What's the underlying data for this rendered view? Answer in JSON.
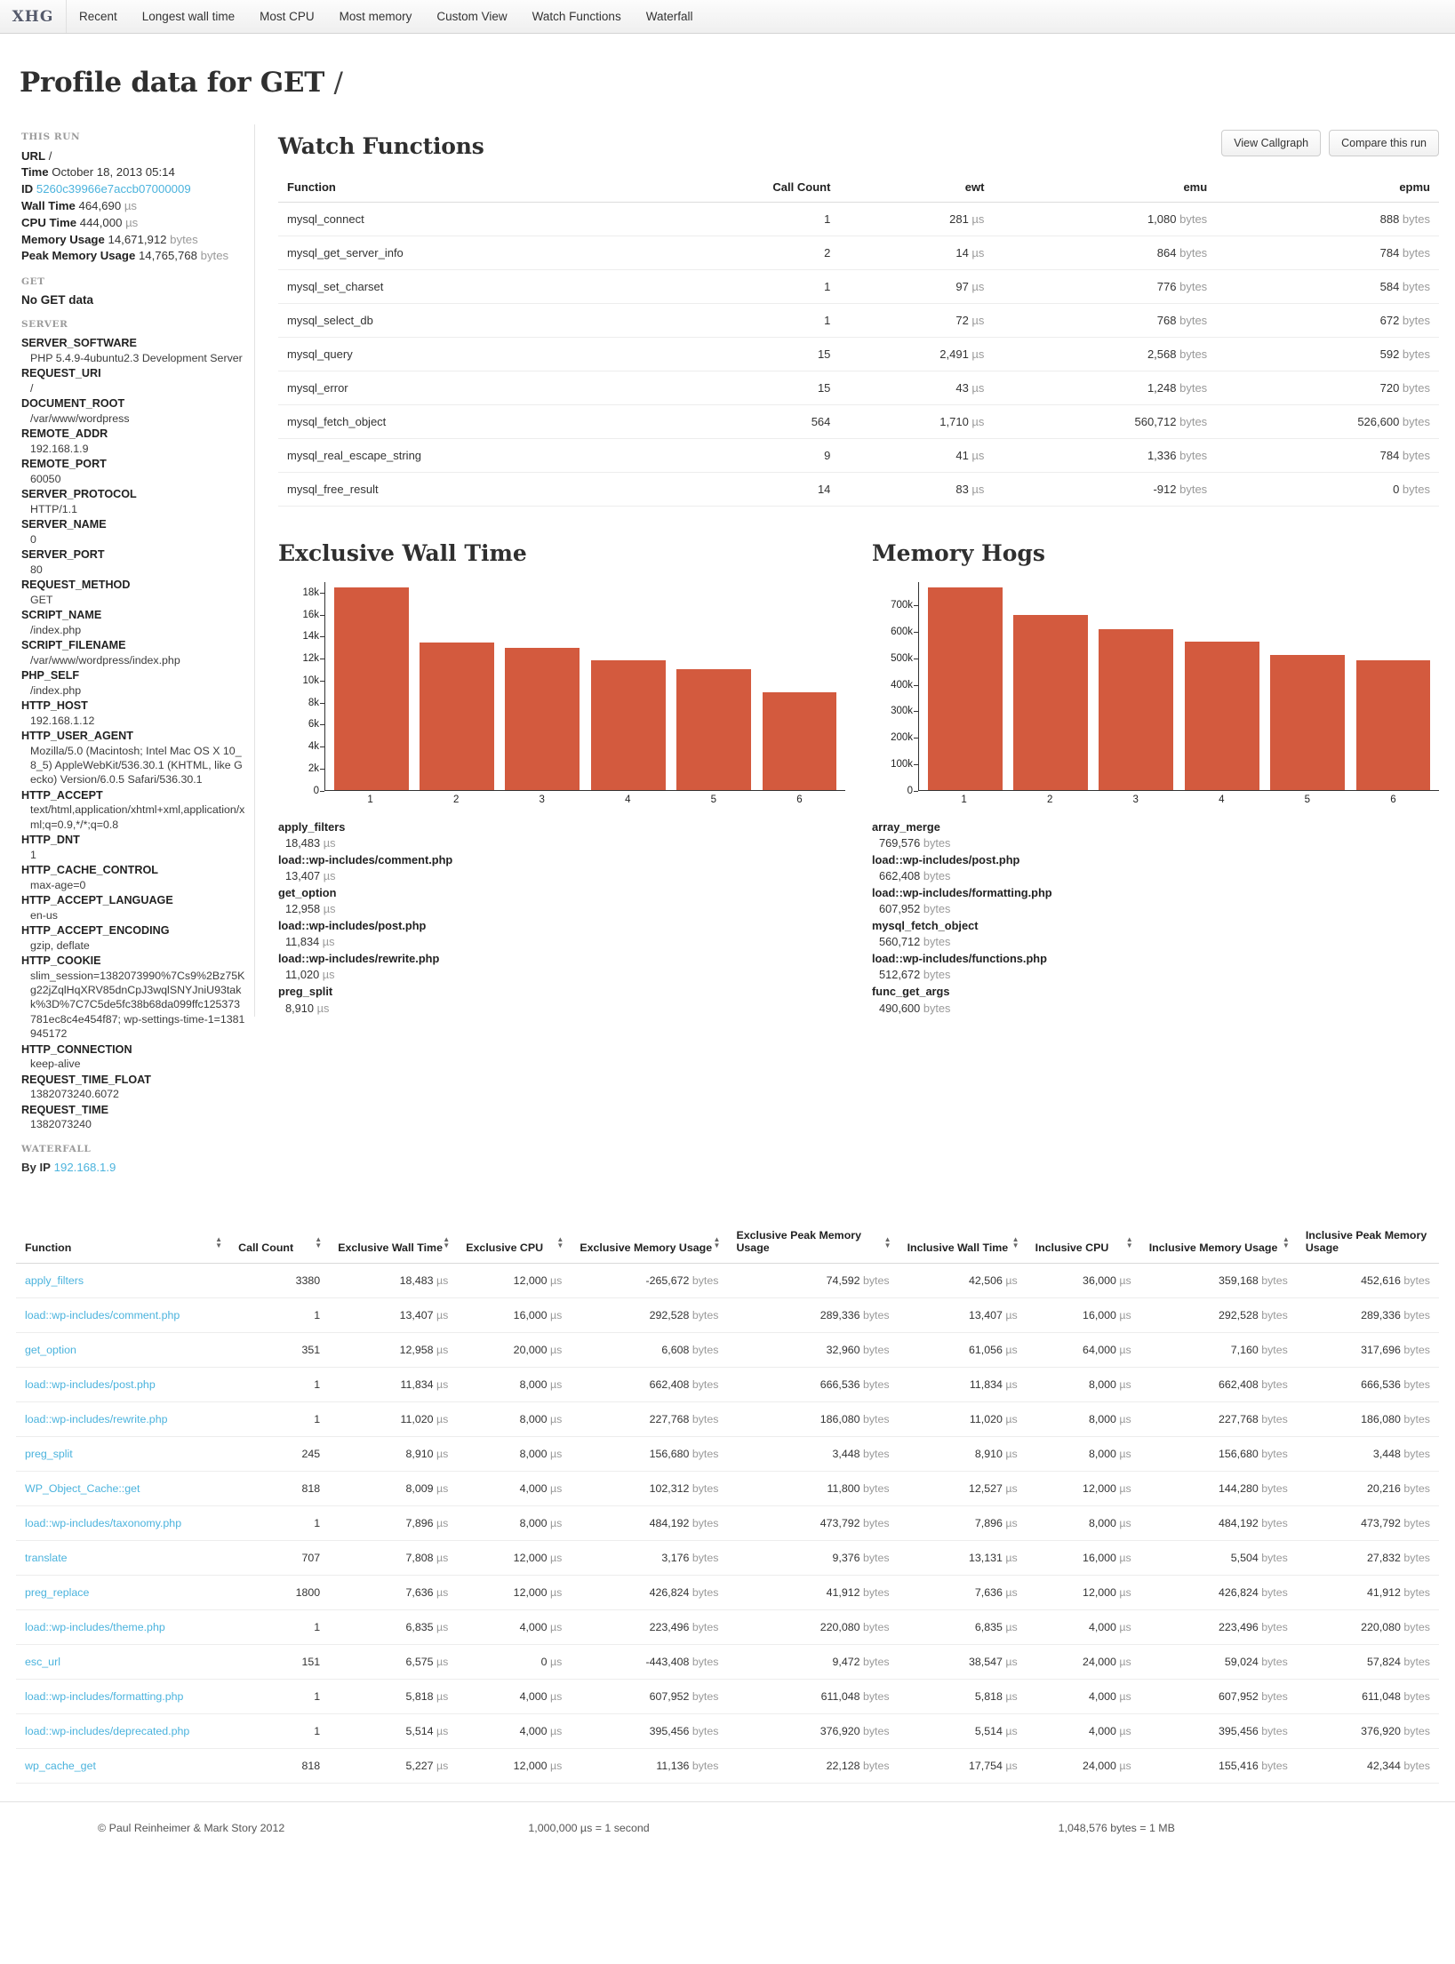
{
  "nav": {
    "brand": "XHG",
    "items": [
      {
        "label": "Recent"
      },
      {
        "label": "Longest wall time"
      },
      {
        "label": "Most CPU"
      },
      {
        "label": "Most memory"
      },
      {
        "label": "Custom View"
      },
      {
        "label": "Watch Functions"
      },
      {
        "label": "Waterfall"
      }
    ]
  },
  "page": {
    "title": "Profile data for GET",
    "title_path": "/"
  },
  "sidebar": {
    "this_run_heading": "THIS RUN",
    "this_run": [
      {
        "key": "URL",
        "value": "/",
        "unit": ""
      },
      {
        "key": "Time",
        "value": "October 18, 2013 05:14",
        "unit": ""
      },
      {
        "key": "ID",
        "value": "5260c39966e7accb07000009",
        "unit": "",
        "link": true
      },
      {
        "key": "Wall Time",
        "value": "464,690",
        "unit": "µs"
      },
      {
        "key": "CPU Time",
        "value": "444,000",
        "unit": "µs"
      },
      {
        "key": "Memory Usage",
        "value": "14,671,912",
        "unit": "bytes"
      },
      {
        "key": "Peak Memory Usage",
        "value": "14,765,768",
        "unit": "bytes"
      }
    ],
    "get_heading": "GET",
    "get_empty": "No GET data",
    "server_heading": "SERVER",
    "server": [
      {
        "key": "SERVER_SOFTWARE",
        "value": "PHP 5.4.9-4ubuntu2.3 Development Server"
      },
      {
        "key": "REQUEST_URI",
        "value": "/"
      },
      {
        "key": "DOCUMENT_ROOT",
        "value": "/var/www/wordpress"
      },
      {
        "key": "REMOTE_ADDR",
        "value": "192.168.1.9"
      },
      {
        "key": "REMOTE_PORT",
        "value": "60050"
      },
      {
        "key": "SERVER_PROTOCOL",
        "value": "HTTP/1.1"
      },
      {
        "key": "SERVER_NAME",
        "value": "0"
      },
      {
        "key": "SERVER_PORT",
        "value": "80"
      },
      {
        "key": "REQUEST_METHOD",
        "value": "GET"
      },
      {
        "key": "SCRIPT_NAME",
        "value": "/index.php"
      },
      {
        "key": "SCRIPT_FILENAME",
        "value": "/var/www/wordpress/index.php"
      },
      {
        "key": "PHP_SELF",
        "value": "/index.php"
      },
      {
        "key": "HTTP_HOST",
        "value": "192.168.1.12"
      },
      {
        "key": "HTTP_USER_AGENT",
        "value": "Mozilla/5.0 (Macintosh; Intel Mac OS X 10_8_5) AppleWebKit/536.30.1 (KHTML, like Gecko) Version/6.0.5 Safari/536.30.1"
      },
      {
        "key": "HTTP_ACCEPT",
        "value": "text/html,application/xhtml+xml,application/xml;q=0.9,*/*;q=0.8"
      },
      {
        "key": "HTTP_DNT",
        "value": "1"
      },
      {
        "key": "HTTP_CACHE_CONTROL",
        "value": "max-age=0"
      },
      {
        "key": "HTTP_ACCEPT_LANGUAGE",
        "value": "en-us"
      },
      {
        "key": "HTTP_ACCEPT_ENCODING",
        "value": "gzip, deflate"
      },
      {
        "key": "HTTP_COOKIE",
        "value": "slim_session=1382073990%7Cs9%2Bz75Kg22jZqlHqXRV85dnCpJ3wqlSNYJniU93takk%3D%7C7C5de5fc38b68da099ffc125373781ec8c4e454f87; wp-settings-time-1=1381945172"
      },
      {
        "key": "HTTP_CONNECTION",
        "value": "keep-alive"
      },
      {
        "key": "REQUEST_TIME_FLOAT",
        "value": "1382073240.6072"
      },
      {
        "key": "REQUEST_TIME",
        "value": "1382073240"
      }
    ],
    "waterfall_heading": "WATERFALL",
    "waterfall_label": "By IP",
    "waterfall_ip": "192.168.1.9"
  },
  "watch": {
    "title": "Watch Functions",
    "buttons": {
      "callgraph": "View Callgraph",
      "compare": "Compare this run"
    },
    "columns": [
      "Function",
      "Call Count",
      "ewt",
      "emu",
      "epmu"
    ],
    "units": {
      "time": "µs",
      "bytes": "bytes"
    },
    "rows": [
      {
        "fn": "mysql_connect",
        "calls": "1",
        "ewt": "281",
        "emu": "1,080",
        "epmu": "888"
      },
      {
        "fn": "mysql_get_server_info",
        "calls": "2",
        "ewt": "14",
        "emu": "864",
        "epmu": "784"
      },
      {
        "fn": "mysql_set_charset",
        "calls": "1",
        "ewt": "97",
        "emu": "776",
        "epmu": "584"
      },
      {
        "fn": "mysql_select_db",
        "calls": "1",
        "ewt": "72",
        "emu": "768",
        "epmu": "672"
      },
      {
        "fn": "mysql_query",
        "calls": "15",
        "ewt": "2,491",
        "emu": "2,568",
        "epmu": "592"
      },
      {
        "fn": "mysql_error",
        "calls": "15",
        "ewt": "43",
        "emu": "1,248",
        "epmu": "720"
      },
      {
        "fn": "mysql_fetch_object",
        "calls": "564",
        "ewt": "1,710",
        "emu": "560,712",
        "epmu": "526,600"
      },
      {
        "fn": "mysql_real_escape_string",
        "calls": "9",
        "ewt": "41",
        "emu": "1,336",
        "epmu": "784"
      },
      {
        "fn": "mysql_free_result",
        "calls": "14",
        "ewt": "83",
        "emu": "-912",
        "epmu": "0"
      }
    ]
  },
  "chart_data": [
    {
      "type": "bar",
      "title": "Exclusive Wall Time",
      "xlabel": "",
      "ylabel": "",
      "categories": [
        "1",
        "2",
        "3",
        "4",
        "5",
        "6"
      ],
      "values": [
        18483,
        13407,
        12958,
        11834,
        11020,
        8910
      ],
      "ylim": [
        0,
        19000
      ],
      "yticks": [
        0,
        2000,
        4000,
        6000,
        8000,
        10000,
        12000,
        14000,
        16000,
        18000
      ],
      "ytick_labels": [
        "0",
        "2k",
        "4k",
        "6k",
        "8k",
        "10k",
        "12k",
        "14k",
        "16k",
        "18k"
      ],
      "grid": false,
      "bar_color": "#d35a3e",
      "unit": "µs",
      "legend": [
        {
          "name": "apply_filters",
          "value": "18,483",
          "unit": "µs"
        },
        {
          "name": "load::wp-includes/comment.php",
          "value": "13,407",
          "unit": "µs"
        },
        {
          "name": "get_option",
          "value": "12,958",
          "unit": "µs"
        },
        {
          "name": "load::wp-includes/post.php",
          "value": "11,834",
          "unit": "µs"
        },
        {
          "name": "load::wp-includes/rewrite.php",
          "value": "11,020",
          "unit": "µs"
        },
        {
          "name": "preg_split",
          "value": "8,910",
          "unit": "µs"
        }
      ]
    },
    {
      "type": "bar",
      "title": "Memory Hogs",
      "xlabel": "",
      "ylabel": "",
      "categories": [
        "1",
        "2",
        "3",
        "4",
        "5",
        "6"
      ],
      "values": [
        769576,
        662408,
        607952,
        560712,
        512672,
        490600
      ],
      "ylim": [
        0,
        790000
      ],
      "yticks": [
        0,
        100000,
        200000,
        300000,
        400000,
        500000,
        600000,
        700000
      ],
      "ytick_labels": [
        "0",
        "100k",
        "200k",
        "300k",
        "400k",
        "500k",
        "600k",
        "700k"
      ],
      "grid": false,
      "bar_color": "#d35a3e",
      "unit": "bytes",
      "legend": [
        {
          "name": "array_merge",
          "value": "769,576",
          "unit": "bytes"
        },
        {
          "name": "load::wp-includes/post.php",
          "value": "662,408",
          "unit": "bytes"
        },
        {
          "name": "load::wp-includes/formatting.php",
          "value": "607,952",
          "unit": "bytes"
        },
        {
          "name": "mysql_fetch_object",
          "value": "560,712",
          "unit": "bytes"
        },
        {
          "name": "load::wp-includes/functions.php",
          "value": "512,672",
          "unit": "bytes"
        },
        {
          "name": "func_get_args",
          "value": "490,600",
          "unit": "bytes"
        }
      ]
    }
  ],
  "bigtable": {
    "columns": [
      "Function",
      "Call Count",
      "Exclusive Wall Time",
      "Exclusive CPU",
      "Exclusive Memory Usage",
      "Exclusive Peak Memory Usage",
      "Inclusive Wall Time",
      "Inclusive CPU",
      "Inclusive Memory Usage",
      "Inclusive Peak Memory Usage"
    ],
    "rows": [
      {
        "fn": "apply_filters",
        "calls": "3380",
        "ewt": "18,483",
        "ecpu": "12,000",
        "emu": "-265,672",
        "epmu": "74,592",
        "iwt": "42,506",
        "icpu": "36,000",
        "imu": "359,168",
        "ipmu": "452,616"
      },
      {
        "fn": "load::wp-includes/comment.php",
        "calls": "1",
        "ewt": "13,407",
        "ecpu": "16,000",
        "emu": "292,528",
        "epmu": "289,336",
        "iwt": "13,407",
        "icpu": "16,000",
        "imu": "292,528",
        "ipmu": "289,336"
      },
      {
        "fn": "get_option",
        "calls": "351",
        "ewt": "12,958",
        "ecpu": "20,000",
        "emu": "6,608",
        "epmu": "32,960",
        "iwt": "61,056",
        "icpu": "64,000",
        "imu": "7,160",
        "ipmu": "317,696"
      },
      {
        "fn": "load::wp-includes/post.php",
        "calls": "1",
        "ewt": "11,834",
        "ecpu": "8,000",
        "emu": "662,408",
        "epmu": "666,536",
        "iwt": "11,834",
        "icpu": "8,000",
        "imu": "662,408",
        "ipmu": "666,536"
      },
      {
        "fn": "load::wp-includes/rewrite.php",
        "calls": "1",
        "ewt": "11,020",
        "ecpu": "8,000",
        "emu": "227,768",
        "epmu": "186,080",
        "iwt": "11,020",
        "icpu": "8,000",
        "imu": "227,768",
        "ipmu": "186,080"
      },
      {
        "fn": "preg_split",
        "calls": "245",
        "ewt": "8,910",
        "ecpu": "8,000",
        "emu": "156,680",
        "epmu": "3,448",
        "iwt": "8,910",
        "icpu": "8,000",
        "imu": "156,680",
        "ipmu": "3,448"
      },
      {
        "fn": "WP_Object_Cache::get",
        "calls": "818",
        "ewt": "8,009",
        "ecpu": "4,000",
        "emu": "102,312",
        "epmu": "11,800",
        "iwt": "12,527",
        "icpu": "12,000",
        "imu": "144,280",
        "ipmu": "20,216"
      },
      {
        "fn": "load::wp-includes/taxonomy.php",
        "calls": "1",
        "ewt": "7,896",
        "ecpu": "8,000",
        "emu": "484,192",
        "epmu": "473,792",
        "iwt": "7,896",
        "icpu": "8,000",
        "imu": "484,192",
        "ipmu": "473,792"
      },
      {
        "fn": "translate",
        "calls": "707",
        "ewt": "7,808",
        "ecpu": "12,000",
        "emu": "3,176",
        "epmu": "9,376",
        "iwt": "13,131",
        "icpu": "16,000",
        "imu": "5,504",
        "ipmu": "27,832"
      },
      {
        "fn": "preg_replace",
        "calls": "1800",
        "ewt": "7,636",
        "ecpu": "12,000",
        "emu": "426,824",
        "epmu": "41,912",
        "iwt": "7,636",
        "icpu": "12,000",
        "imu": "426,824",
        "ipmu": "41,912"
      },
      {
        "fn": "load::wp-includes/theme.php",
        "calls": "1",
        "ewt": "6,835",
        "ecpu": "4,000",
        "emu": "223,496",
        "epmu": "220,080",
        "iwt": "6,835",
        "icpu": "4,000",
        "imu": "223,496",
        "ipmu": "220,080"
      },
      {
        "fn": "esc_url",
        "calls": "151",
        "ewt": "6,575",
        "ecpu": "0",
        "emu": "-443,408",
        "epmu": "9,472",
        "iwt": "38,547",
        "icpu": "24,000",
        "imu": "59,024",
        "ipmu": "57,824"
      },
      {
        "fn": "load::wp-includes/formatting.php",
        "calls": "1",
        "ewt": "5,818",
        "ecpu": "4,000",
        "emu": "607,952",
        "epmu": "611,048",
        "iwt": "5,818",
        "icpu": "4,000",
        "imu": "607,952",
        "ipmu": "611,048"
      },
      {
        "fn": "load::wp-includes/deprecated.php",
        "calls": "1",
        "ewt": "5,514",
        "ecpu": "4,000",
        "emu": "395,456",
        "epmu": "376,920",
        "iwt": "5,514",
        "icpu": "4,000",
        "imu": "395,456",
        "ipmu": "376,920"
      },
      {
        "fn": "wp_cache_get",
        "calls": "818",
        "ewt": "5,227",
        "ecpu": "12,000",
        "emu": "11,136",
        "epmu": "22,128",
        "iwt": "17,754",
        "icpu": "24,000",
        "imu": "155,416",
        "ipmu": "42,344"
      }
    ]
  },
  "footer": {
    "copyright": "© Paul Reinheimer & Mark Story 2012",
    "time_note": "1,000,000 µs = 1 second",
    "bytes_note": "1,048,576 bytes = 1 MB"
  }
}
